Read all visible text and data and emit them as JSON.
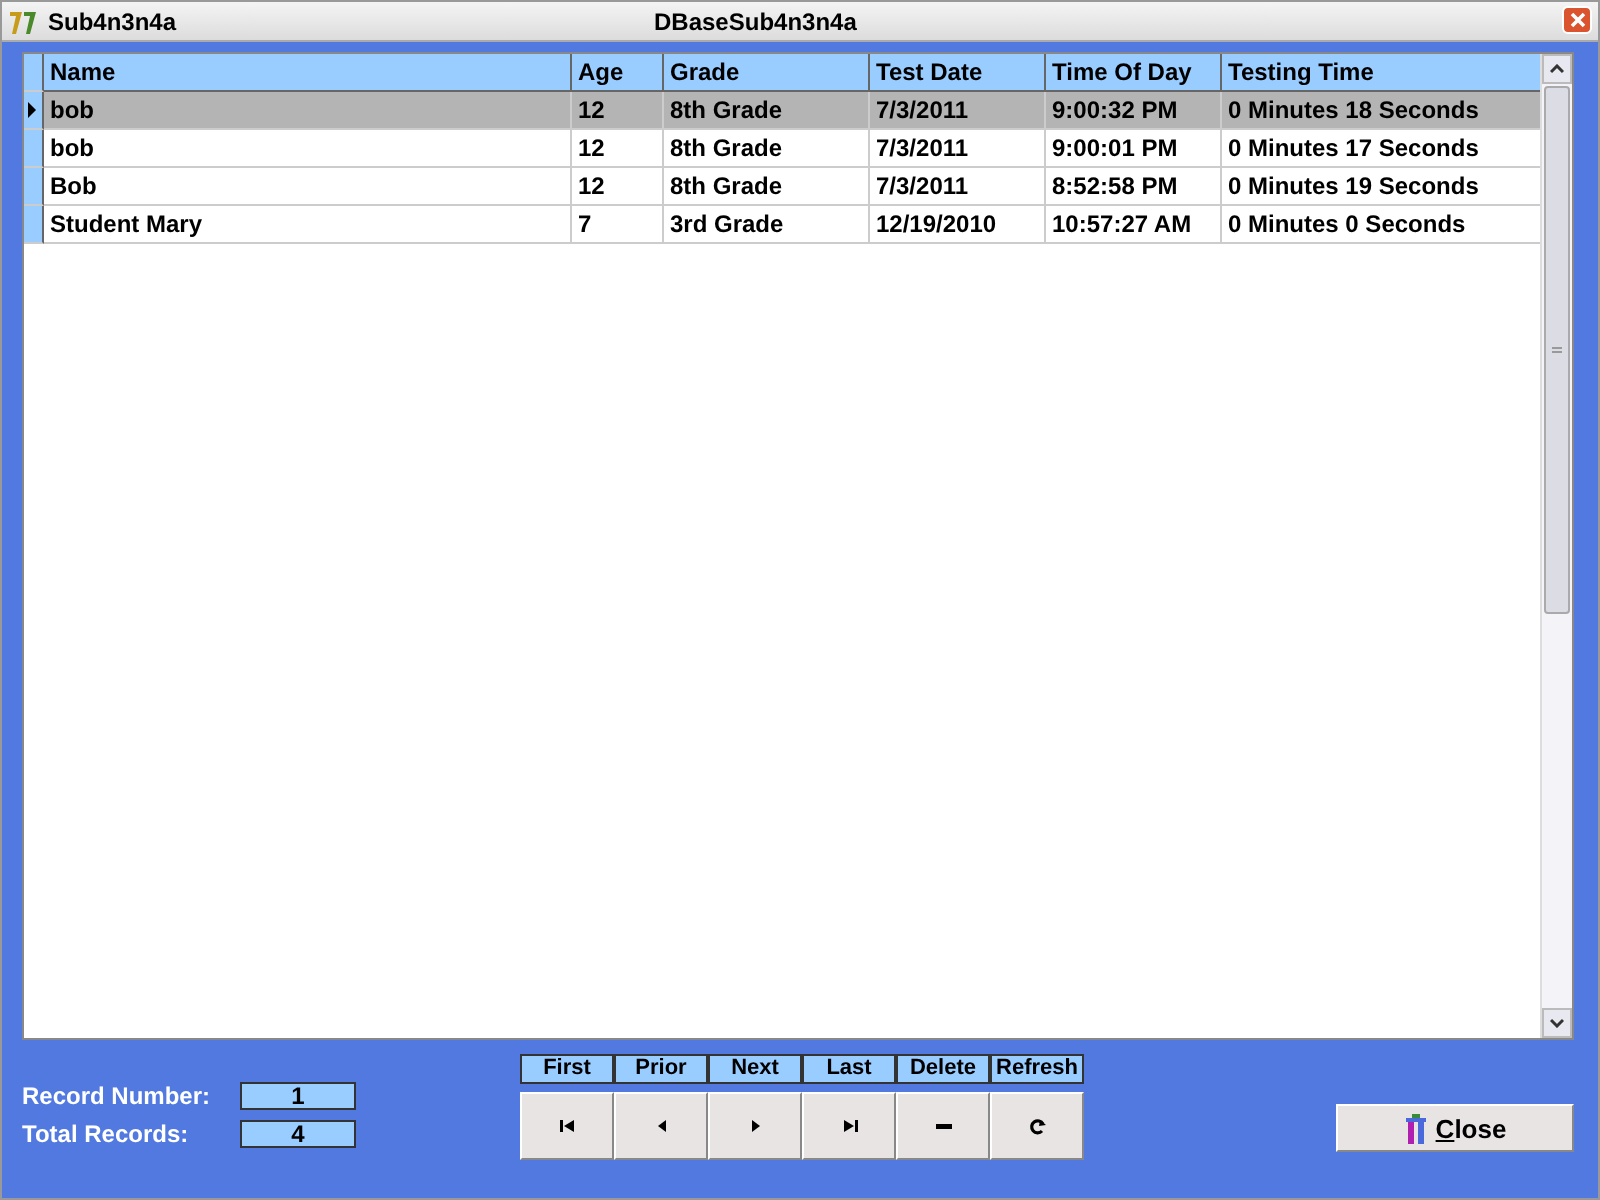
{
  "window": {
    "title": "Sub4n3n4a",
    "caption": "DBaseSub4n3n4a"
  },
  "table": {
    "columns": [
      "Name",
      "Age",
      "Grade",
      "Test Date",
      "Time Of Day",
      "Testing Time"
    ],
    "rows": [
      {
        "selected": true,
        "cells": [
          "bob",
          "12",
          "8th Grade",
          "7/3/2011",
          "9:00:32 PM",
          "0 Minutes  18 Seconds"
        ]
      },
      {
        "selected": false,
        "cells": [
          "bob",
          "12",
          "8th Grade",
          "7/3/2011",
          "9:00:01 PM",
          "0 Minutes  17 Seconds"
        ]
      },
      {
        "selected": false,
        "cells": [
          "Bob",
          "12",
          "8th Grade",
          "7/3/2011",
          "8:52:58 PM",
          "0 Minutes  19 Seconds"
        ]
      },
      {
        "selected": false,
        "cells": [
          "Student Mary",
          "7",
          "3rd Grade",
          "12/19/2010",
          "10:57:27 AM",
          "0 Minutes  0 Seconds"
        ]
      }
    ]
  },
  "record_info": [
    {
      "label": "Record Number:",
      "value": "1"
    },
    {
      "label": "Total Records:",
      "value": "4"
    }
  ],
  "navigator": [
    {
      "kind": "first",
      "label": "First"
    },
    {
      "kind": "prior",
      "label": "Prior"
    },
    {
      "kind": "next",
      "label": "Next"
    },
    {
      "kind": "last",
      "label": "Last"
    },
    {
      "kind": "delete",
      "label": "Delete"
    },
    {
      "kind": "refresh",
      "label": "Refresh"
    }
  ],
  "close_button": {
    "label": "Close",
    "first_letter_underlined": true
  }
}
